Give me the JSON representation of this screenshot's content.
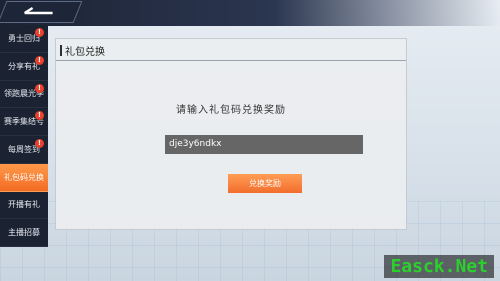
{
  "sidebar": {
    "items": [
      {
        "label": "勇士回归",
        "badge": "!"
      },
      {
        "label": "分享有礼",
        "badge": "!"
      },
      {
        "label": "领跑晨光季",
        "badge": "!"
      },
      {
        "label": "赛季集结号",
        "badge": "!"
      },
      {
        "label": "每周签到",
        "badge": "!"
      },
      {
        "label": "礼包码兑换",
        "badge": ""
      },
      {
        "label": "开播有礼",
        "badge": ""
      },
      {
        "label": "主播招募",
        "badge": ""
      }
    ]
  },
  "panel": {
    "title": "礼包兑换",
    "prompt": "请输入礼包码兑换奖励",
    "code_value": "dje3y6ndkx",
    "redeem_label": "兑换奖励"
  },
  "watermark": "Easck.Net",
  "colors": {
    "accent": "#f36b24",
    "sidebar_bg": "#1b2232",
    "badge": "#e8402a"
  }
}
